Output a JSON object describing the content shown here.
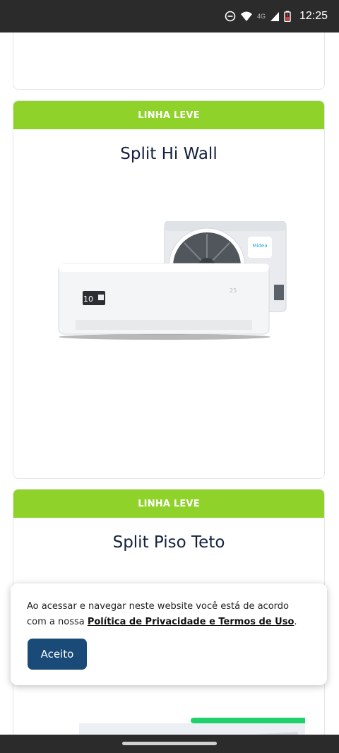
{
  "status_bar": {
    "time": "12:25",
    "network": "4G",
    "icons": [
      "do-not-disturb-icon",
      "wifi-icon",
      "signal-icon",
      "battery-icon"
    ]
  },
  "cards": [
    {
      "band_label": "LINHA LEVE",
      "title": "Split Hi Wall",
      "image": "split-hi-wall-ac-image",
      "product_badge": "10"
    },
    {
      "band_label": "LINHA LEVE",
      "title": "Split Piso Teto",
      "image": "split-piso-teto-ac-image"
    }
  ],
  "cookie_banner": {
    "text": "Ao acessar e navegar neste website você está de acordo com a nossa ",
    "link_text": "Política de Privacidade e Termos de Uso",
    "text_end": ".",
    "button_label": "Aceito"
  },
  "colors": {
    "band": "#8fd32a",
    "title": "#14213d",
    "button": "#1a4a78",
    "status_bar": "#2b2b2b"
  }
}
